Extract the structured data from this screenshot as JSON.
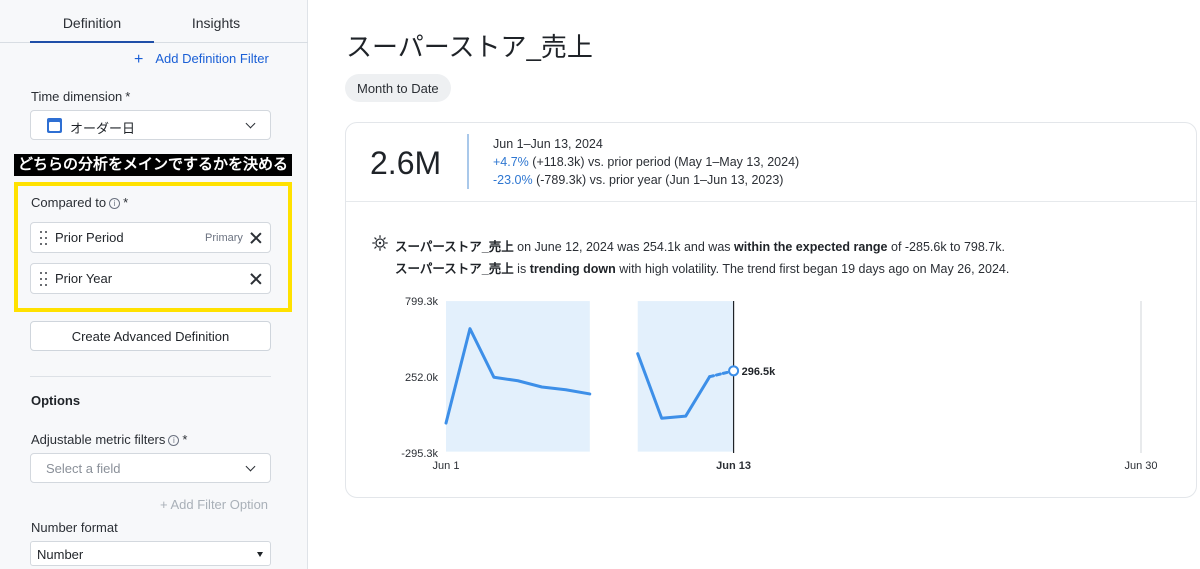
{
  "sidebar": {
    "tabs": [
      {
        "label": "Definition",
        "active": true
      },
      {
        "label": "Insights",
        "active": false
      }
    ],
    "add_definition_filter": "Add Definition Filter",
    "time_dimension": {
      "label": "Time dimension",
      "required_mark": "*",
      "value": "オーダー日",
      "icon": "calendar-icon"
    },
    "annotation": "どちらの分析をメインでするかを決める",
    "compared_to": {
      "label": "Compared to",
      "required_mark": "*",
      "items": [
        {
          "label": "Prior Period",
          "badge": "Primary"
        },
        {
          "label": "Prior Year",
          "badge": ""
        }
      ]
    },
    "create_advanced_definition": "Create Advanced Definition",
    "options_heading": "Options",
    "adjustable_metric_filters": {
      "label": "Adjustable metric filters",
      "required_mark": "*",
      "placeholder": "Select a field"
    },
    "add_filter_option": "+ Add Filter Option",
    "number_format": {
      "label": "Number format",
      "value": "Number"
    }
  },
  "main": {
    "title": "スーパーストア_売上",
    "date_pill": "Month to Date",
    "summary": {
      "value": "2.6M",
      "period": "Jun 1–Jun 13, 2024",
      "prior_period_change": "+4.7%",
      "prior_period_detail": "(+118.3k) vs. prior period (May 1–May 13, 2024)",
      "prior_year_change": "-23.0%",
      "prior_year_detail": "(-789.3k) vs. prior year (Jun 1–Jun 13, 2023)"
    },
    "insight": {
      "line1": {
        "metric": "スーパーストア_売上",
        "text1": " on June 12, 2024 was 254.1k and was ",
        "emph": "within the expected range",
        "text2": " of -285.6k to 798.7k."
      },
      "line2": {
        "metric": "スーパーストア_売上",
        "text1": " is ",
        "emph": "trending down",
        "text2": " with high volatility. The trend first began 19 days ago on May 26, 2024."
      }
    }
  },
  "colors": {
    "accent": "#2f77d1",
    "line": "#3d8fe8",
    "band": "#e3f0fc",
    "highlight": "#ffe100",
    "negative": "#2f77d1"
  },
  "chart_data": {
    "type": "line",
    "yticks": [
      "799.3k",
      "252.0k",
      "-295.3k"
    ],
    "ylim": [
      -295.3,
      799.3
    ],
    "xticks": [
      "Jun 1",
      "Jun 13",
      "Jun 30"
    ],
    "x_range_days": [
      1,
      30
    ],
    "current_label": "296.5k",
    "series": [
      {
        "segment": "prior",
        "x": [
          1,
          2,
          3,
          4,
          5,
          6,
          7
        ],
        "y": [
          -80,
          600,
          250,
          225,
          180,
          160,
          130
        ]
      },
      {
        "segment": "current",
        "x": [
          9,
          10,
          11,
          12
        ],
        "y": [
          420,
          -45,
          -30,
          254.1
        ]
      },
      {
        "segment": "projected",
        "x": [
          12,
          13
        ],
        "y": [
          254.1,
          296.5
        ]
      }
    ],
    "expected_range": {
      "bands": [
        [
          1,
          7
        ],
        [
          9,
          13
        ]
      ],
      "low": -285.6,
      "high": 798.7
    }
  }
}
